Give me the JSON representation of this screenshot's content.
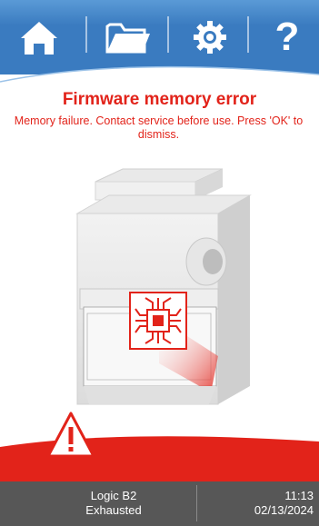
{
  "nav": {
    "items": [
      {
        "icon": "home-icon"
      },
      {
        "icon": "folder-icon"
      },
      {
        "icon": "gear-icon"
      },
      {
        "icon": "help-icon",
        "glyph": "?"
      }
    ]
  },
  "alert": {
    "title": "Firmware memory error",
    "message": "Memory failure. Contact service before use. Press 'OK' to dismiss."
  },
  "status": {
    "model": "Logic B2",
    "mode": "Exhausted",
    "time": "11:13",
    "date": "02/13/2024"
  },
  "colors": {
    "nav_blue": "#3a7bc0",
    "alert_red": "#e2231a",
    "status_gray": "#575757"
  }
}
